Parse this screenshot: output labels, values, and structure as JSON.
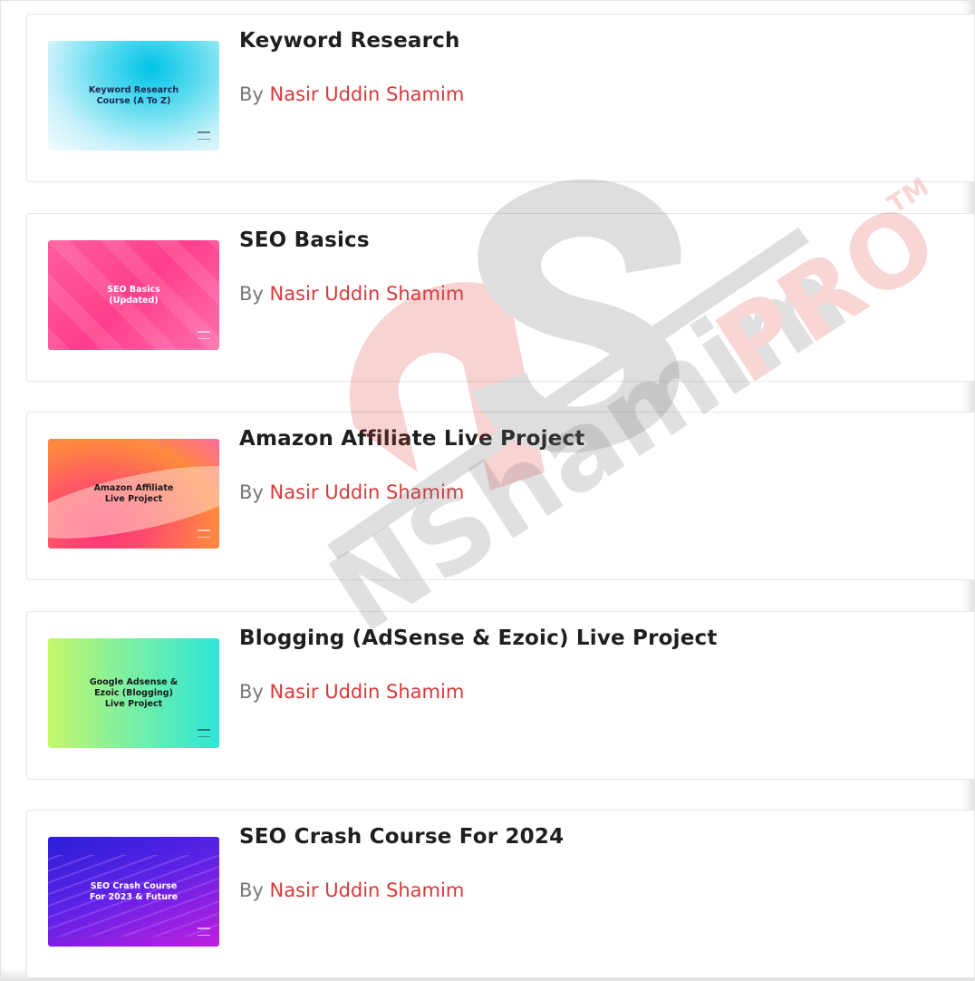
{
  "courses": [
    {
      "title": "Keyword Research",
      "by_label": "By",
      "author": "Nasir Uddin Shamim",
      "thumbnail_text": "Keyword Research\nCourse (A To Z)"
    },
    {
      "title": "SEO Basics",
      "by_label": "By",
      "author": "Nasir Uddin Shamim",
      "thumbnail_text": "SEO Basics\n(Updated)"
    },
    {
      "title": "Amazon Affiliate Live Project",
      "by_label": "By",
      "author": "Nasir Uddin Shamim",
      "thumbnail_text": "Amazon Affiliate\nLive Project"
    },
    {
      "title": "Blogging (AdSense & Ezoic) Live Project",
      "by_label": "By",
      "author": "Nasir Uddin Shamim",
      "thumbnail_text": "Google Adsense &\nEzoic (Blogging)\nLive Project"
    },
    {
      "title": "SEO Crash Course For 2024",
      "by_label": "By",
      "author": "Nasir Uddin Shamim",
      "thumbnail_text": "SEO Crash Course\nFor 2023 & Future"
    }
  ],
  "watermark": {
    "text_primary": "NShamim",
    "text_accent": "PRO",
    "trademark": "TM"
  },
  "colors": {
    "author_accent": "#d73a3a",
    "title": "#1f1f1f",
    "watermark_red": "#e03a3a",
    "watermark_gray": "#6b6b6b"
  }
}
